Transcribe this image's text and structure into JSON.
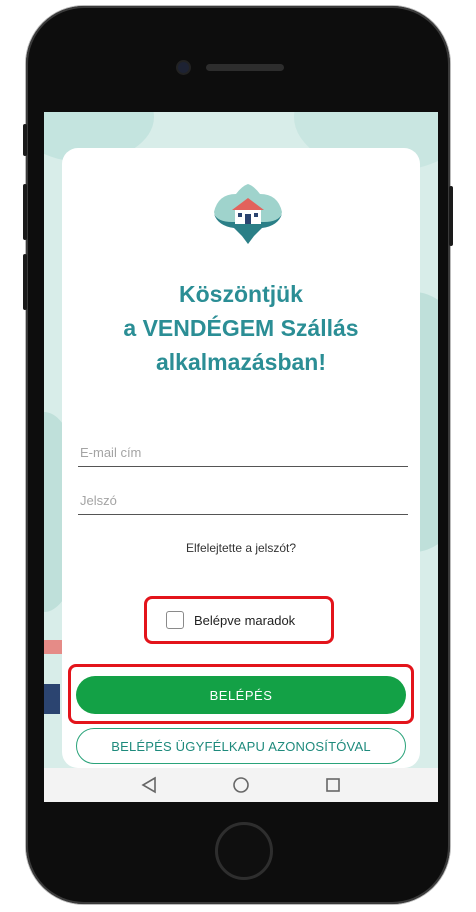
{
  "welcome": {
    "line1": "Köszöntjük",
    "line2": "a VENDÉGEM Szállás",
    "line3": "alkalmazásban!"
  },
  "form": {
    "email_placeholder": "E-mail cím",
    "password_placeholder": "Jelszó",
    "forgot_password": "Elfelejtette a jelszót?",
    "remember_me": "Belépve maradok",
    "remember_checked": false
  },
  "buttons": {
    "login": "BELÉPÉS",
    "ugyfelkapu_login": "BELÉPÉS ÜGYFÉLKAPU AZONOSÍTÓVAL"
  },
  "navbar": {
    "icons": [
      "back-icon",
      "home-icon",
      "recents-icon"
    ]
  },
  "colors": {
    "accent_teal": "#2b8e95",
    "login_green": "#13a146",
    "highlight_red": "#e3141b",
    "background_mint": "#d8ede9"
  }
}
